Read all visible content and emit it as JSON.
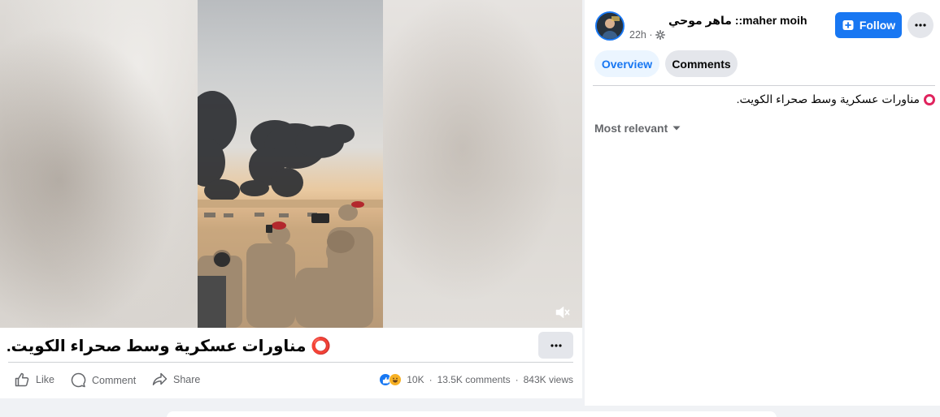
{
  "video": {
    "mute_icon": "speaker-muted-icon"
  },
  "caption": {
    "text": "⭕️ مناورات عسكرية وسط صحراء الكويت.",
    "more_icon": "ellipsis-icon"
  },
  "actions": {
    "like_label": "Like",
    "comment_label": "Comment",
    "share_label": "Share"
  },
  "stats": {
    "reactions_count": "10K",
    "comments_count": "13.5K comments",
    "views_count": "843K views",
    "separator": "·",
    "reaction_icons": [
      "like-reaction-icon",
      "haha-reaction-icon"
    ]
  },
  "post_header": {
    "author": "ماهر موحي ::maher moih",
    "time": "22h ·",
    "audience_icon": "gear-icon",
    "follow_label": "Follow",
    "follow_icon": "follow-plus-icon",
    "more_icon": "ellipsis-icon"
  },
  "tabs": [
    {
      "label": "Overview",
      "active": true
    },
    {
      "label": "Comments",
      "active": false
    }
  ],
  "post_body": {
    "text": "مناورات عسكرية وسط صحراء الكويت."
  },
  "comments_sort": {
    "label": "Most relevant",
    "icon": "caret-down-icon"
  },
  "colors": {
    "brand_blue": "#1877f2",
    "ring_red": "#e0245e",
    "muted_text": "#65676b"
  }
}
